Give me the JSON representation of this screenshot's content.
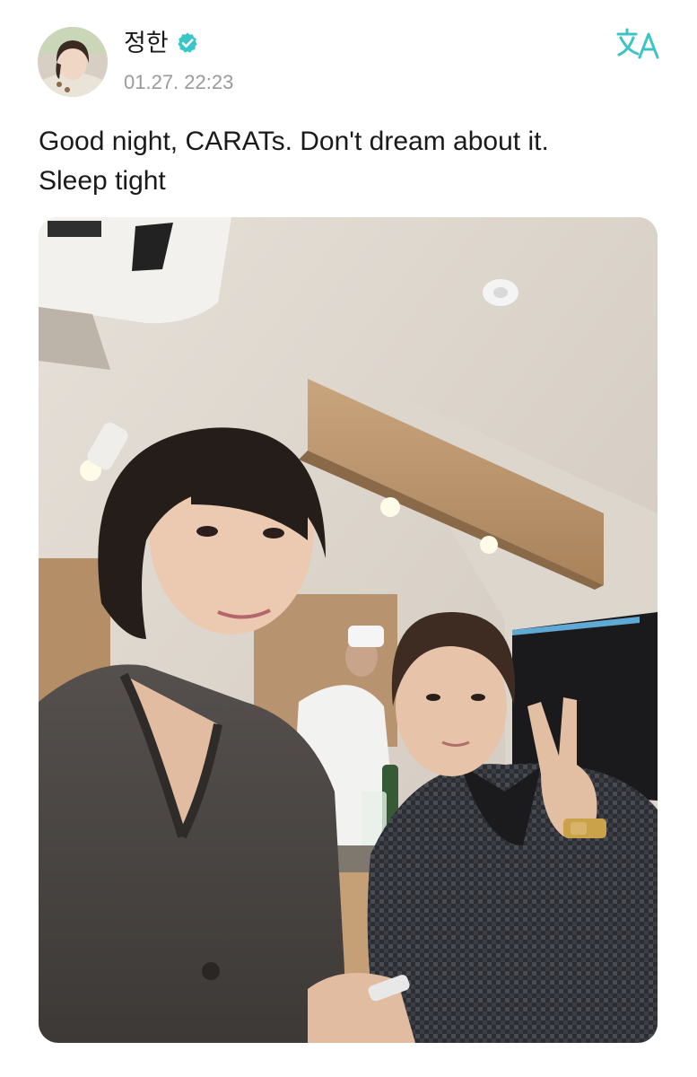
{
  "post": {
    "author": {
      "name": "정한",
      "verified": true,
      "avatar_icon": "avatar-photo"
    },
    "timestamp": "01.27. 22:23",
    "translate_icon": "translate-icon",
    "text_lines": [
      "Good night, CARATs. Don't dream about it.",
      "Sleep tight"
    ],
    "photo": {
      "subject": "selfie-two-people-restaurant"
    }
  },
  "colors": {
    "accent_teal": "#3cc4c4",
    "verified": "#38c6c9",
    "text": "#1a1a1a",
    "muted": "#9a9a9a"
  }
}
